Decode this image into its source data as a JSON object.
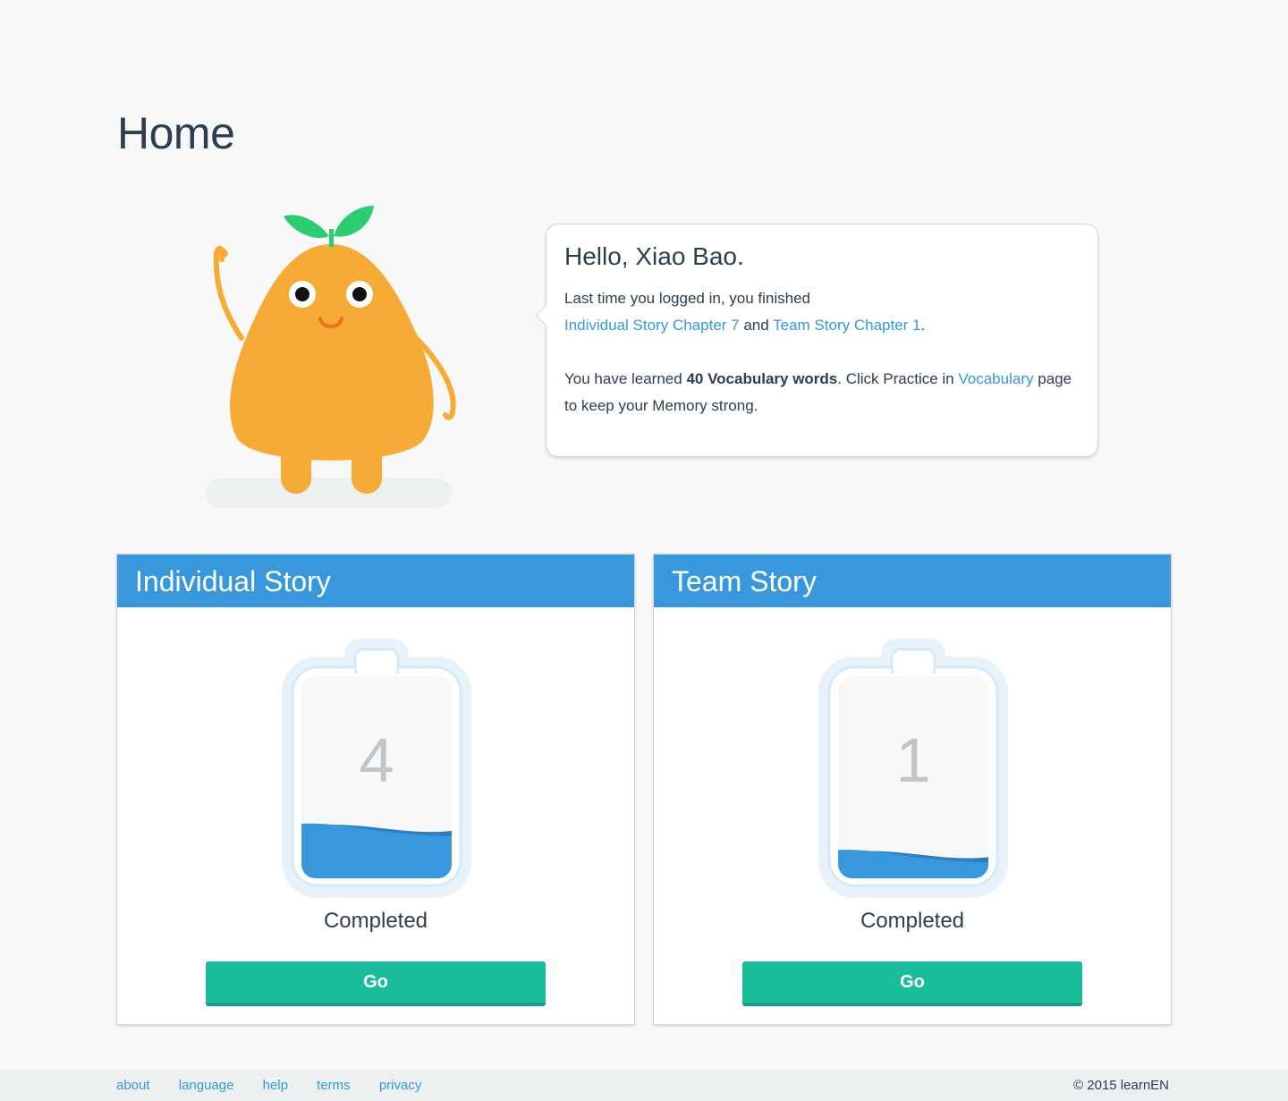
{
  "page": {
    "title": "Home"
  },
  "greeting": {
    "hello": "Hello, Xiao Bao.",
    "last_login_text": "Last time you logged in, you finished",
    "individual_link": "Individual Story Chapter 7",
    "and_text": "and",
    "team_link": "Team Story Chapter 1",
    "period": ".",
    "learned_prefix": "You have learned",
    "learned_count": "40 Vocabulary words",
    "learned_mid": ". Click Practice in",
    "vocabulary_link": "Vocabulary",
    "learned_suffix": "page to keep your Memory strong."
  },
  "cards": [
    {
      "title": "Individual Story",
      "count": "4",
      "fill_fraction": 0.27,
      "status": "Completed",
      "button": "Go"
    },
    {
      "title": "Team Story",
      "count": "1",
      "fill_fraction": 0.14,
      "status": "Completed",
      "button": "Go"
    }
  ],
  "footer": {
    "links": [
      "about",
      "language",
      "help",
      "terms",
      "privacy"
    ],
    "copyright": "© 2015 learnEN"
  },
  "colors": {
    "primary_blue": "#3898db",
    "link_blue": "#3498db",
    "button_green": "#1abc9c",
    "mascot_orange": "#f5ab35",
    "leaf_green": "#2ecc71"
  },
  "icons": {
    "mascot": "orange-mascot-waving",
    "battery": "battery-progress-icon"
  }
}
